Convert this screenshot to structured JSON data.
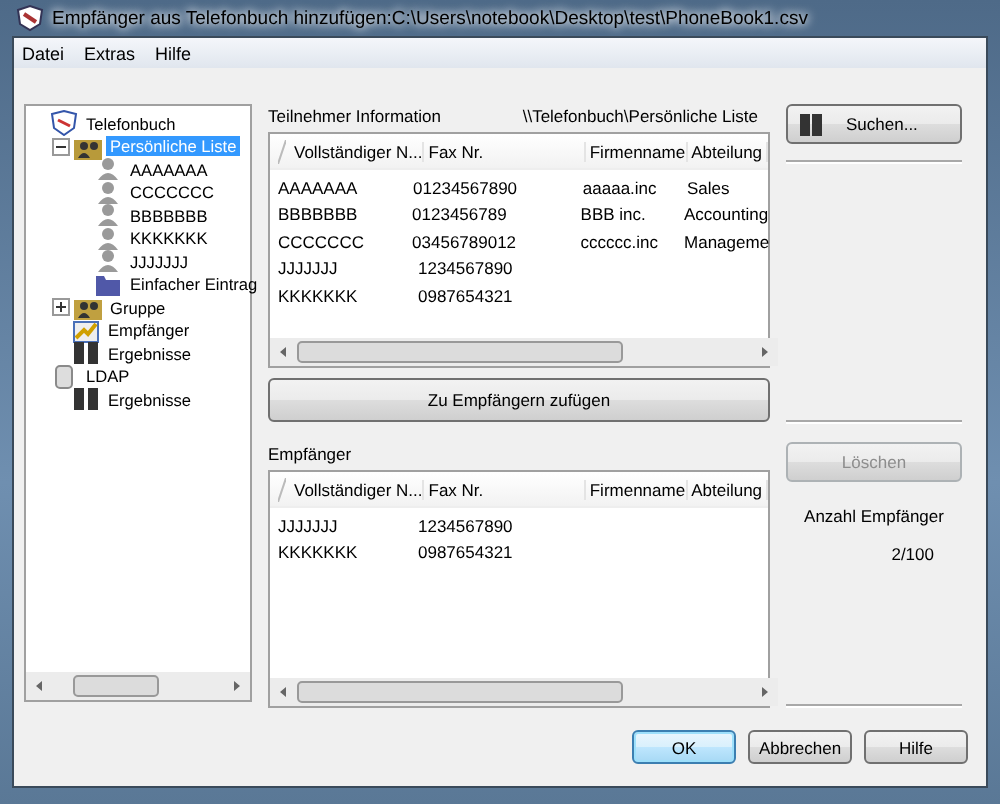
{
  "window": {
    "title": "Empfänger aus Telefonbuch hinzufügen:C:\\Users\\notebook\\Desktop\\test\\PhoneBook1.csv"
  },
  "menu": [
    "Datei",
    "Extras",
    "Hilfe"
  ],
  "tree": [
    {
      "label": "Telefonbuch",
      "kind": "phonebook",
      "selected": false,
      "children": [
        {
          "label": "Persönliche Liste",
          "kind": "people",
          "selected": true,
          "expanded": true,
          "children": [
            {
              "label": "AAAAAAA",
              "kind": "person",
              "selected": false
            },
            {
              "label": "CCCCCCC",
              "kind": "person",
              "selected": false
            },
            {
              "label": "BBBBBBB",
              "kind": "person",
              "selected": false
            },
            {
              "label": "KKKKKKK",
              "kind": "person",
              "selected": false
            },
            {
              "label": "JJJJJJJ",
              "kind": "person",
              "selected": false
            },
            {
              "label": "Einfacher Eintrag",
              "kind": "folder",
              "selected": false
            }
          ]
        },
        {
          "label": "Gruppe",
          "kind": "group",
          "selected": false,
          "expanded": false
        },
        {
          "label": "Empfänger",
          "kind": "recipients",
          "selected": false
        },
        {
          "label": "Ergebnisse",
          "kind": "results",
          "selected": false
        }
      ]
    },
    {
      "label": "LDAP",
      "kind": "ldap",
      "selected": false,
      "children": [
        {
          "label": "Ergebnisse",
          "kind": "results",
          "selected": false
        }
      ]
    }
  ],
  "members": {
    "label": "Teilnehmer Information",
    "path": "\\\\Telefonbuch\\Persönliche Liste",
    "columns": [
      "Vollständiger N...",
      "Fax Nr.",
      "Firmenname",
      "Abteilung"
    ],
    "rows": [
      [
        "AAAAAAA",
        "01234567890",
        "aaaaa.inc",
        "Sales"
      ],
      [
        "BBBBBBB",
        "0123456789",
        "BBB inc.",
        "Accounting"
      ],
      [
        "CCCCCCC",
        "03456789012",
        "cccccc.inc",
        "Manageme"
      ],
      [
        "JJJJJJJ",
        "1234567890"
      ],
      [
        "KKKKKKK",
        "0987654321"
      ]
    ]
  },
  "add_button": "Zu Empfängern zufügen",
  "recipients": {
    "label": "Empfänger",
    "columns": [
      "Vollständiger N...",
      "Fax Nr.",
      "Firmenname",
      "Abteilung"
    ],
    "rows": [
      [
        "JJJJJJJ",
        "1234567890"
      ],
      [
        "KKKKKKK",
        "0987654321"
      ]
    ]
  },
  "search_button": "Suchen...",
  "delete_button": {
    "label": "Löschen",
    "disabled": true
  },
  "count_label": "Anzahl Empfänger",
  "count": "2/100",
  "buttons": [
    "OK",
    "Abbrechen",
    "Hilfe"
  ]
}
